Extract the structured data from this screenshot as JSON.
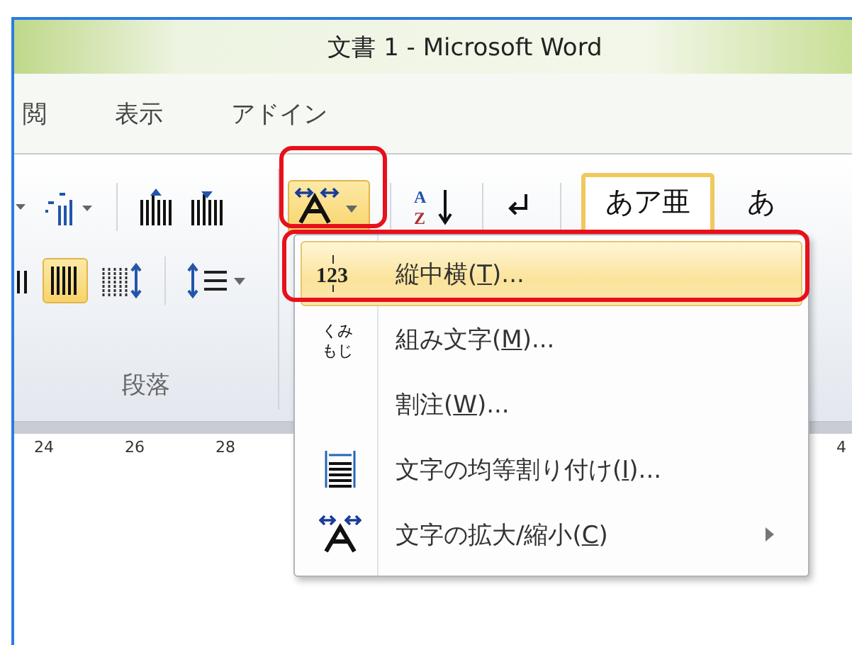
{
  "window": {
    "title": "文書 1 - Microsoft Word"
  },
  "tabs": [
    {
      "label": "閲",
      "selected": false
    },
    {
      "label": "表示",
      "selected": false
    },
    {
      "label": "アドイン",
      "selected": false
    }
  ],
  "ribbon": {
    "group_label": "段落",
    "text_direction_button": {
      "pressed": true
    },
    "distribute_button": {
      "pressed": true
    },
    "sort_icon": {
      "top": "A",
      "bottom": "Z"
    },
    "styles": [
      {
        "label": "あア亜",
        "selected": true
      },
      {
        "label": "あ",
        "selected": false
      }
    ]
  },
  "ruler": {
    "marks": [
      "24",
      "26",
      "28",
      "4"
    ]
  },
  "menu": {
    "items": [
      {
        "kind": "tate",
        "icon_text": [
          "123"
        ],
        "parts": [
          "縦中横(",
          "T",
          ")..."
        ],
        "selected": true,
        "submenu": false
      },
      {
        "kind": "kumi",
        "icon_text": [
          "くみ",
          "もじ"
        ],
        "parts": [
          "組み文字(",
          "M",
          ")..."
        ],
        "selected": false,
        "submenu": false
      },
      {
        "kind": "none",
        "parts": [
          "割注(",
          "W",
          ")..."
        ],
        "selected": false,
        "submenu": false
      },
      {
        "kind": "even",
        "parts": [
          "文字の均等割り付け(",
          "I",
          ")..."
        ],
        "selected": false,
        "submenu": false
      },
      {
        "kind": "scale",
        "parts": [
          "文字の拡大/縮小(",
          "C",
          ")"
        ],
        "selected": false,
        "submenu": true
      }
    ]
  }
}
